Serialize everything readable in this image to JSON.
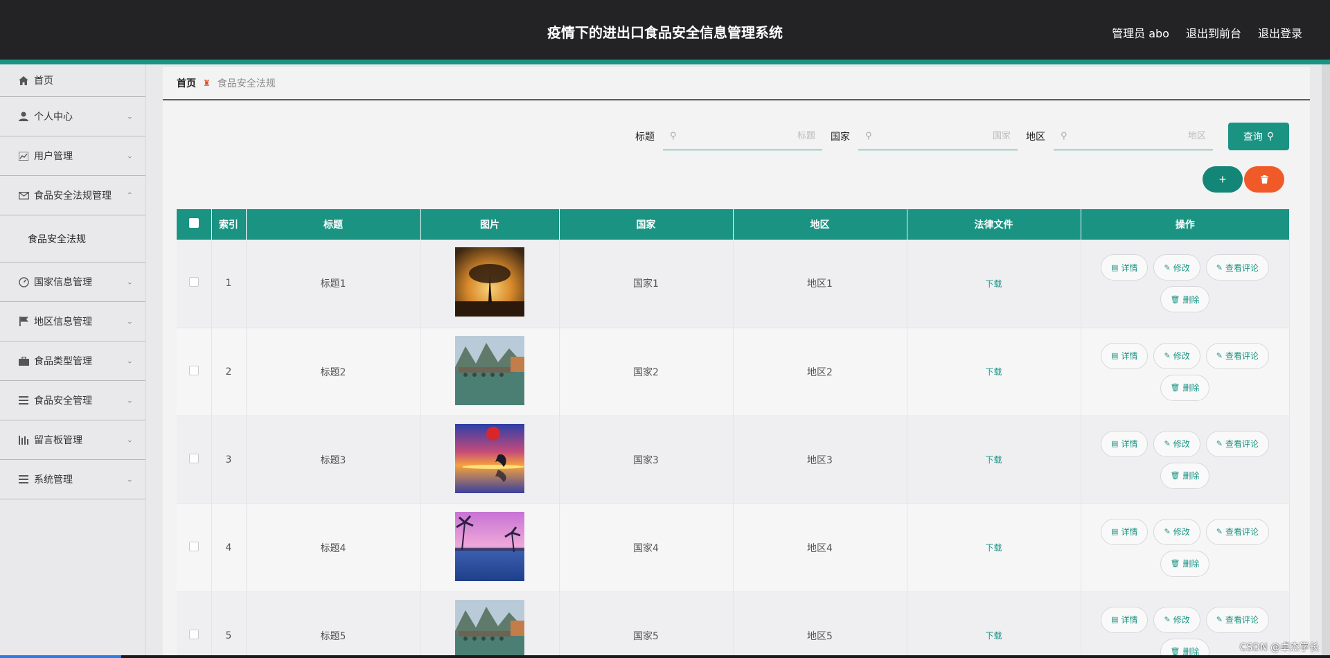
{
  "header": {
    "title": "疫情下的进出口食品安全信息管理系统",
    "admin": "管理员 abo",
    "front": "退出到前台",
    "logout": "退出登录"
  },
  "sidebar": {
    "items": [
      {
        "label": "首页",
        "icon": "home-icon"
      },
      {
        "label": "个人中心",
        "icon": "user-icon"
      },
      {
        "label": "用户管理",
        "icon": "chart-icon"
      },
      {
        "label": "食品安全法规管理",
        "icon": "mail-icon",
        "expanded": true
      },
      {
        "label": "国家信息管理",
        "icon": "gauge-icon"
      },
      {
        "label": "地区信息管理",
        "icon": "flag-icon"
      },
      {
        "label": "食品类型管理",
        "icon": "briefcase-icon"
      },
      {
        "label": "食品安全管理",
        "icon": "list-icon"
      },
      {
        "label": "留言板管理",
        "icon": "bars-icon"
      },
      {
        "label": "系统管理",
        "icon": "list-icon"
      }
    ],
    "submenu": "食品安全法规"
  },
  "breadcrumb": {
    "home": "首页",
    "current": "食品安全法规"
  },
  "search": {
    "title_label": "标题",
    "title_placeholder": "标题",
    "country_label": "国家",
    "country_placeholder": "国家",
    "region_label": "地区",
    "region_placeholder": "地区",
    "query": "查询"
  },
  "table": {
    "headers": [
      "",
      "索引",
      "标题",
      "图片",
      "国家",
      "地区",
      "法律文件",
      "操作"
    ],
    "rows": [
      {
        "index": "1",
        "title": "标题1",
        "country": "国家1",
        "region": "地区1",
        "file": "下载",
        "img": "sunset-tree"
      },
      {
        "index": "2",
        "title": "标题2",
        "country": "国家2",
        "region": "地区2",
        "file": "下载",
        "img": "bridge-river"
      },
      {
        "index": "3",
        "title": "标题3",
        "country": "国家3",
        "region": "地区3",
        "file": "下载",
        "img": "dolphin-sunset"
      },
      {
        "index": "4",
        "title": "标题4",
        "country": "国家4",
        "region": "地区4",
        "file": "下载",
        "img": "palm-lake"
      },
      {
        "index": "5",
        "title": "标题5",
        "country": "国家5",
        "region": "地区5",
        "file": "下载",
        "img": "bridge-river"
      }
    ],
    "ops": {
      "detail": "详情",
      "edit": "修改",
      "comments": "查看评论",
      "delete": "删除"
    }
  },
  "watermark": "CSDN @卓杰学长"
}
